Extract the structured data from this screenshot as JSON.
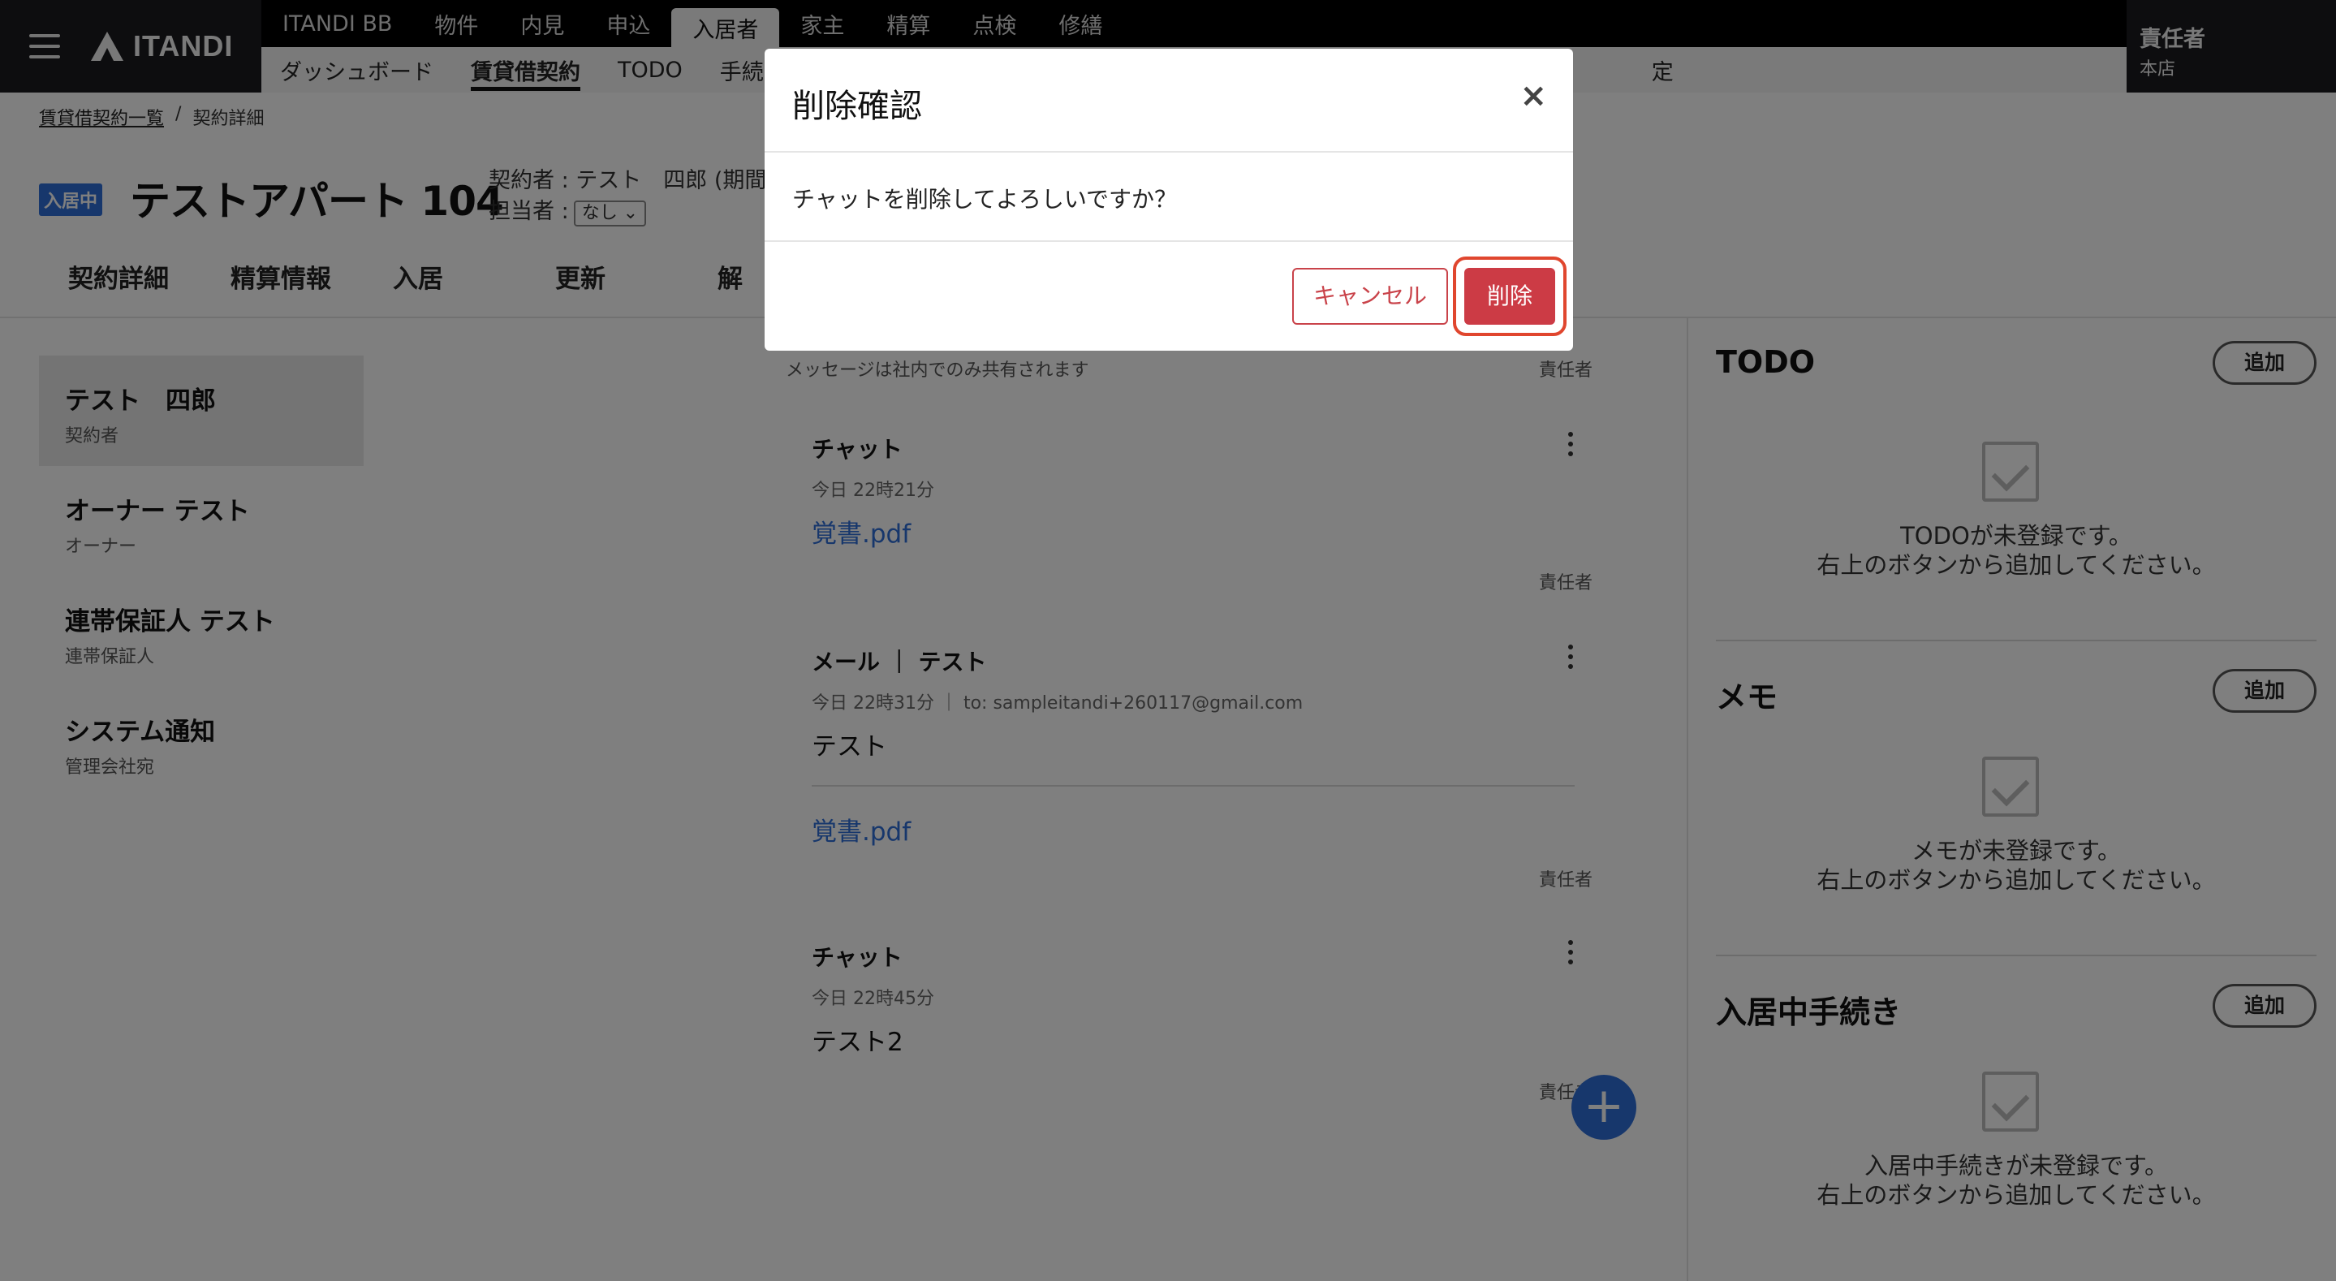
{
  "brand": {
    "name": "ITANDI"
  },
  "nav": {
    "main": [
      "ITANDI BB",
      "物件",
      "内見",
      "申込",
      "入居者",
      "家主",
      "精算",
      "点検",
      "修繕"
    ],
    "sub": [
      "ダッシュボード",
      "賃貸借契約",
      "TODO",
      "手続",
      "",
      "",
      "",
      "",
      "",
      "",
      "",
      "",
      "",
      "",
      "",
      "",
      "定"
    ]
  },
  "user": {
    "role": "責任者",
    "branch": "本店"
  },
  "breadcrumb": {
    "parent": "賃貸借契約一覧",
    "separator": "/",
    "current": "契約詳細"
  },
  "header": {
    "status": "入居中",
    "title": "テストアパート 104",
    "contractor": "契約者 : テスト　四郎 (期間",
    "assignee_label": "担当者 :",
    "assignee_value": "なし ⌄"
  },
  "tabs": [
    "契約詳細",
    "精算情報",
    "入居",
    "更新",
    "解"
  ],
  "sidebar": {
    "items": [
      {
        "name": "テスト　四郎",
        "role": "契約者"
      },
      {
        "name": "オーナー テスト",
        "role": "オーナー"
      },
      {
        "name": "連帯保証人 テスト",
        "role": "連帯保証人"
      },
      {
        "name": "システム通知",
        "role": "管理会社宛"
      }
    ]
  },
  "messages": {
    "notice": "メッセージは社内でのみ共有されます",
    "items": [
      {
        "sender": "責任者",
        "title": "チャット",
        "meta": "今日 22時21分",
        "link": "覚書.pdf"
      },
      {
        "sender": "責任者",
        "title": "メール ｜ テスト",
        "meta": "今日 22時31分 ｜ to: sampleitandi+260117@gmail.com",
        "body": "テスト",
        "link": "覚書.pdf"
      },
      {
        "sender": "責任者",
        "title": "チャット",
        "meta": "今日 22時45分",
        "body": "テスト2"
      },
      {
        "sender": "責任者"
      }
    ],
    "fab": "+"
  },
  "right": {
    "add_label": "追加",
    "sections": [
      {
        "title": "TODO",
        "empty1": "TODOが未登録です。",
        "empty2": "右上のボタンから追加してください。"
      },
      {
        "title": "メモ",
        "empty1": "メモが未登録です。",
        "empty2": "右上のボタンから追加してください。"
      },
      {
        "title": "入居中手続き",
        "empty1": "入居中手続きが未登録です。",
        "empty2": "右上のボタンから追加してください。"
      }
    ]
  },
  "modal": {
    "title": "削除確認",
    "close": "×",
    "body": "チャットを削除してよろしいですか？",
    "cancel": "キャンセル",
    "delete": "削除"
  },
  "colors": {
    "accent": "#2f6fd8",
    "danger": "#cc3b45",
    "highlight": "#e0462e"
  }
}
